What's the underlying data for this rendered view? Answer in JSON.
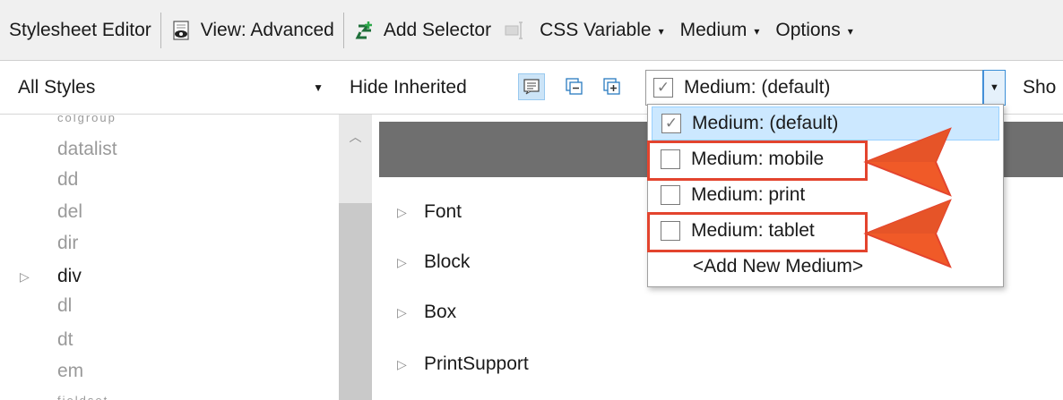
{
  "toolbar": {
    "title": "Stylesheet Editor",
    "view_label": "View: Advanced",
    "add_selector_label": "Add Selector",
    "css_variable_label": "CSS Variable",
    "medium_label": "Medium",
    "options_label": "Options"
  },
  "filter_bar": {
    "styles_combo_value": "All Styles",
    "hide_inherited_label": "Hide Inherited",
    "medium_combo_value": "Medium: (default)",
    "show_label_partial": "Sho"
  },
  "medium_dropdown": {
    "options": [
      {
        "label": "Medium: (default)",
        "checked": true,
        "selected": true,
        "highlighted": false
      },
      {
        "label": "Medium: mobile",
        "checked": false,
        "selected": false,
        "highlighted": true
      },
      {
        "label": "Medium: print",
        "checked": false,
        "selected": false,
        "highlighted": false
      },
      {
        "label": "Medium: tablet",
        "checked": false,
        "selected": false,
        "highlighted": true
      }
    ],
    "add_new_label": "<Add New Medium>"
  },
  "tree": {
    "items": [
      {
        "label": "datalist",
        "expandable": false,
        "bold": false
      },
      {
        "label": "dd",
        "expandable": false,
        "bold": false
      },
      {
        "label": "del",
        "expandable": false,
        "bold": false
      },
      {
        "label": "dir",
        "expandable": false,
        "bold": false
      },
      {
        "label": "div",
        "expandable": true,
        "bold": true
      },
      {
        "label": "dl",
        "expandable": false,
        "bold": false
      },
      {
        "label": "dt",
        "expandable": false,
        "bold": false
      },
      {
        "label": "em",
        "expandable": false,
        "bold": false
      }
    ]
  },
  "properties": {
    "groups": [
      "Font",
      "Block",
      "Box",
      "PrintSupport"
    ]
  },
  "colors": {
    "callout_red": "#e3442e",
    "callout_orange": "#f05a28",
    "selection_blue": "#cce8ff",
    "header_gray": "#6f6f6f"
  }
}
